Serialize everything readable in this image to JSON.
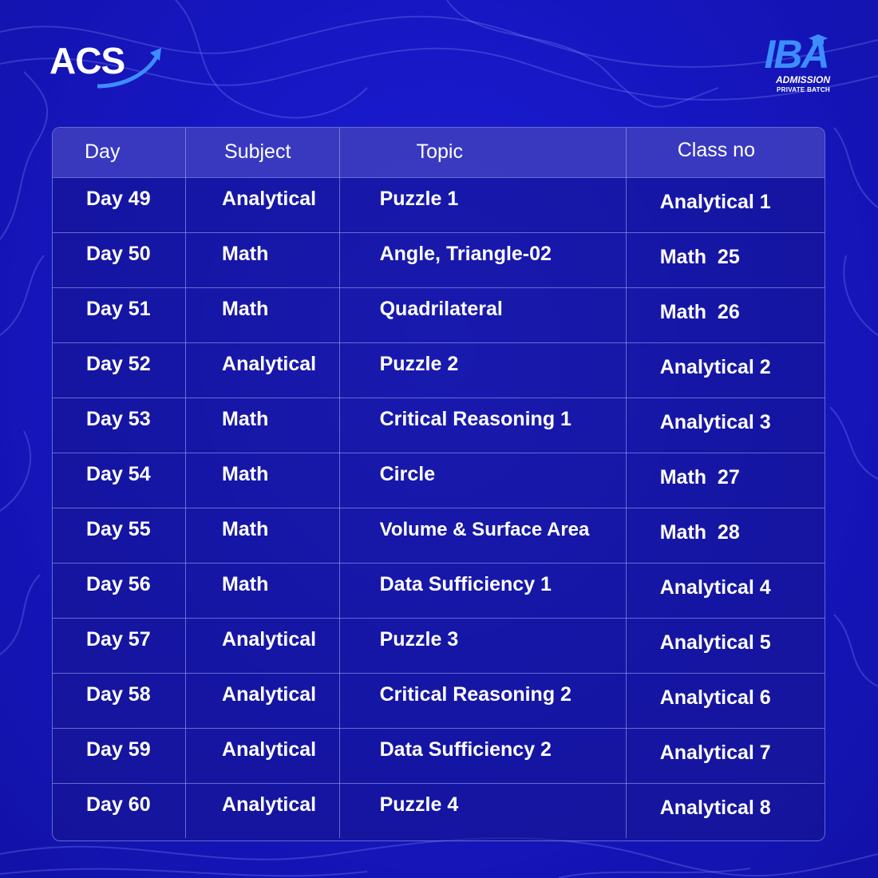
{
  "logos": {
    "left": {
      "text": "ACS",
      "icon": "arrow-up-right-icon"
    },
    "right": {
      "text": "IBA",
      "sub1": "ADMISSION",
      "sub2": "PRIVATE BATCH",
      "icon": "graduation-cap-icon"
    }
  },
  "colors": {
    "background": "#1717c4",
    "header_row": "#4646c8",
    "brand_blue": "#3d8dff",
    "text": "#ffffff"
  },
  "table": {
    "headers": [
      "Day",
      "Subject",
      "Topic",
      "Class no"
    ],
    "rows": [
      [
        "Day 49",
        "Analytical",
        "Puzzle 1",
        "Analytical 1"
      ],
      [
        "Day 50",
        "Math",
        "Angle, Triangle-02",
        "Math  25"
      ],
      [
        "Day 51",
        "Math",
        "Quadrilateral",
        "Math  26"
      ],
      [
        "Day 52",
        "Analytical",
        "Puzzle 2",
        "Analytical 2"
      ],
      [
        "Day 53",
        "Math",
        "Critical Reasoning 1",
        "Analytical 3"
      ],
      [
        "Day 54",
        "Math",
        "Circle",
        "Math  27"
      ],
      [
        "Day 55",
        "Math",
        "Volume & Surface Area",
        "Math  28"
      ],
      [
        "Day 56",
        "Math",
        "Data Sufficiency 1",
        "Analytical 4"
      ],
      [
        "Day 57",
        "Analytical",
        "Puzzle 3",
        "Analytical 5"
      ],
      [
        "Day 58",
        "Analytical",
        "Critical Reasoning 2",
        "Analytical 6"
      ],
      [
        "Day 59",
        "Analytical",
        "Data Sufficiency 2",
        "Analytical 7"
      ],
      [
        "Day 60",
        "Analytical",
        "Puzzle 4",
        "Analytical 8"
      ]
    ]
  }
}
